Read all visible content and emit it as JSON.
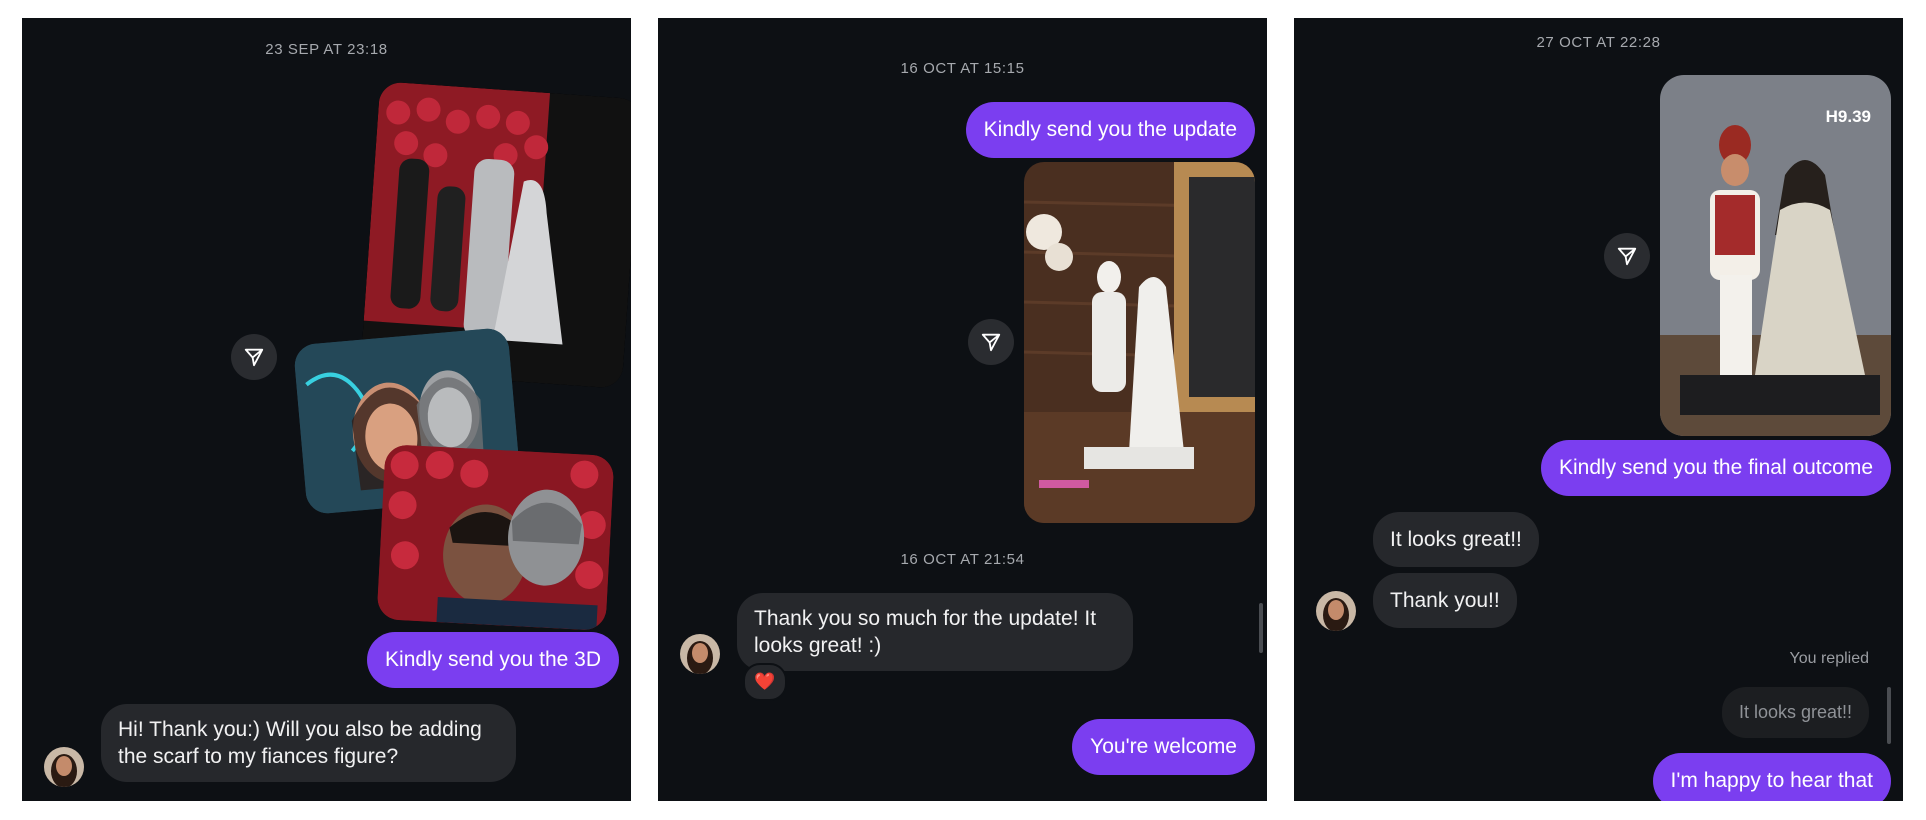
{
  "panel1": {
    "timestamp": "23 SEP AT 23:18",
    "out_message": "Kindly send you the 3D",
    "in_message": "Hi! Thank you:) Will you also be adding the scarf to my fiances figure?"
  },
  "panel2": {
    "timestamp1": "16 OCT AT 15:15",
    "out_message1": "Kindly send you the update",
    "timestamp2": "16 OCT AT 21:54",
    "in_message": "Thank you so much for the update! It looks great! :)",
    "reaction": "❤️",
    "out_message2": "You're welcome"
  },
  "panel3": {
    "timestamp": "27 OCT AT 22:28",
    "photo_label": "H9.39",
    "out_message1": "Kindly send you the final outcome",
    "in_message1": "It looks great!!",
    "in_message2": "Thank you!!",
    "replied_label": "You replied",
    "quoted_message": "It looks great!!",
    "out_message2": "I'm happy to hear that"
  },
  "colors": {
    "background": "#0d1014",
    "outgoing_bubble": "#7b3ef0",
    "incoming_bubble": "#26282c",
    "timestamp_text": "#a6a9ae"
  },
  "icons": [
    "share-icon",
    "heart-icon"
  ]
}
